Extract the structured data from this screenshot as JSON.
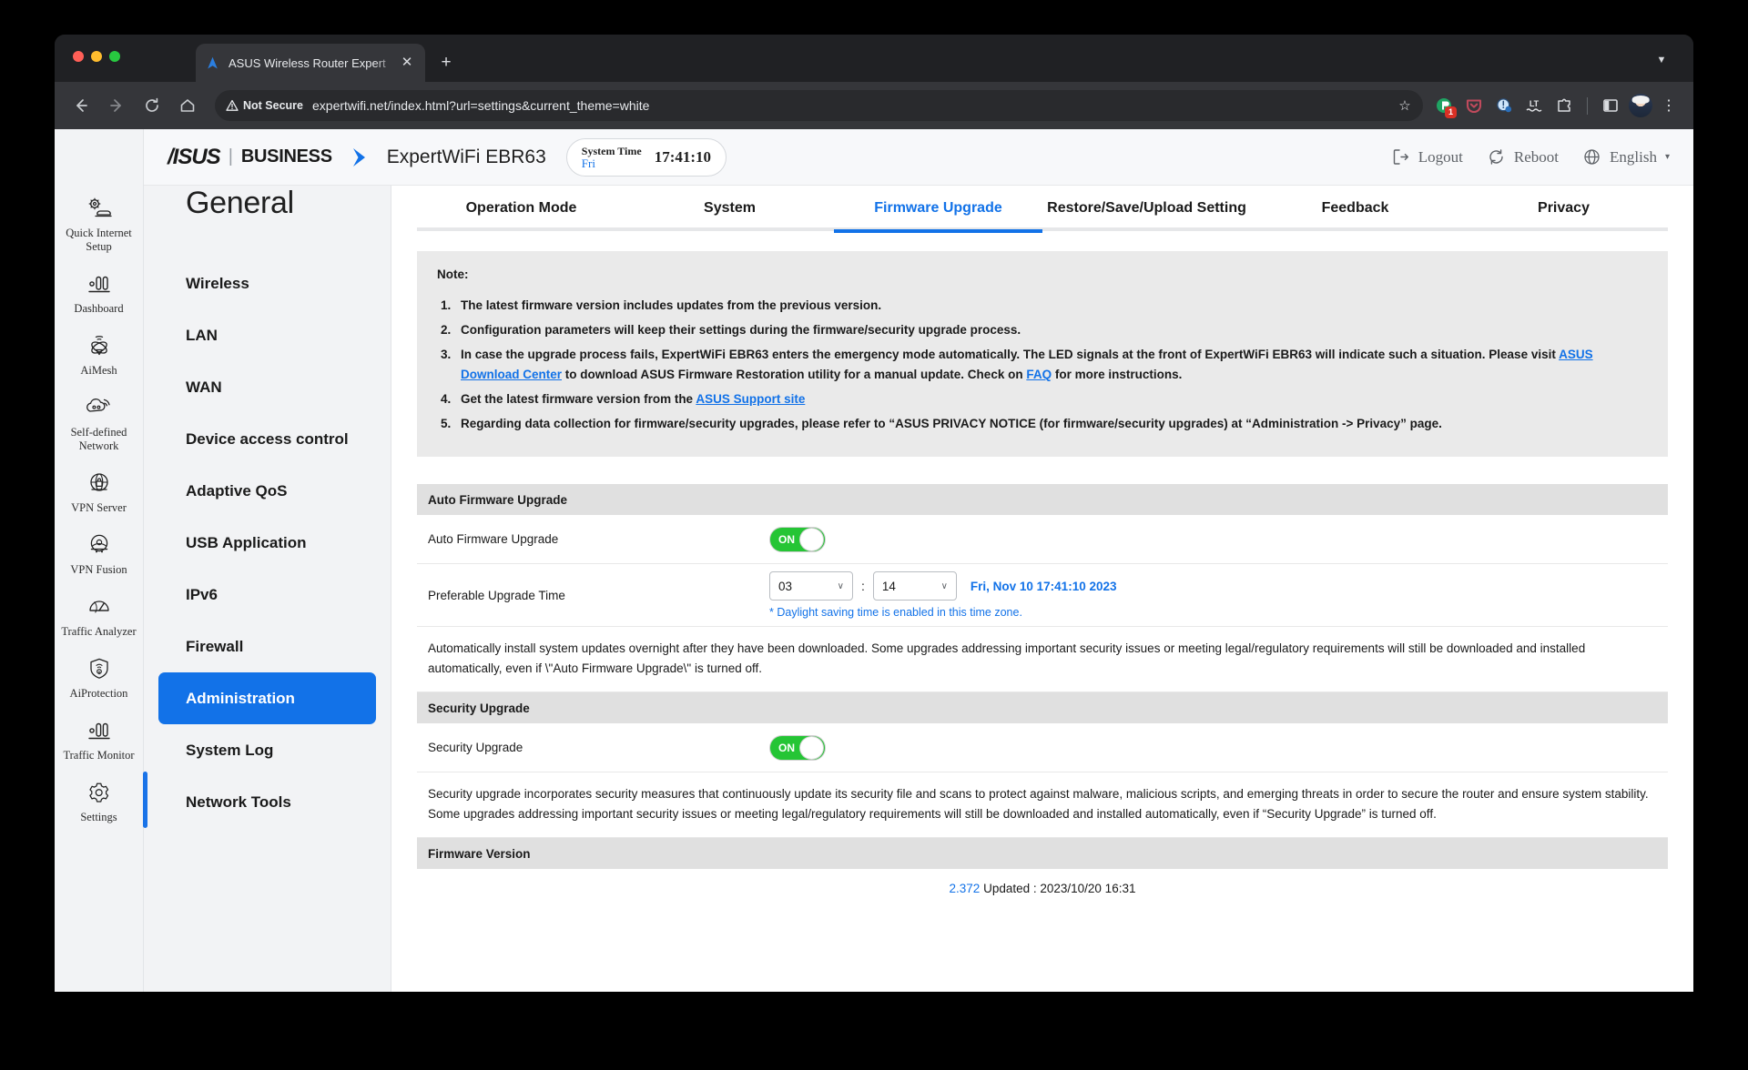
{
  "browser": {
    "tab": {
      "title": "ASUS Wireless Router Expert",
      "close_label": "✕"
    },
    "new_tab_label": "+",
    "tab_list_label": "▼",
    "nav": {
      "back": "←",
      "forward": "→",
      "reload": "⟳",
      "home": "⌂"
    },
    "omnibox": {
      "security_label": "Not Secure",
      "warning_icon": "warning-triangle-icon",
      "url": "expertwifi.net/index.html?url=settings&current_theme=white",
      "star": "☆"
    },
    "extensions": [
      {
        "name": "password-manager-extension",
        "badge": "1"
      },
      {
        "name": "pocket-extension",
        "badge": ""
      },
      {
        "name": "privacy-badger-extension",
        "badge": ""
      },
      {
        "name": "languagetool-extension",
        "badge": ""
      },
      {
        "name": "extensions-puzzle-icon",
        "badge": ""
      }
    ],
    "side_panel_label": "side-panel-icon",
    "profile_label": "profile-avatar",
    "menu_label": "⋮"
  },
  "header": {
    "brand": "/ISUS",
    "divider": "|",
    "business": "BUSINESS",
    "model": "ExpertWiFi EBR63",
    "system_time": {
      "label": "System Time",
      "day": "Fri",
      "clock": "17:41:10"
    },
    "logout": "Logout",
    "reboot": "Reboot",
    "language": "English",
    "language_caret": "▾"
  },
  "rail": {
    "items": [
      {
        "label": "Quick Internet Setup",
        "icon": "quick-internet-setup-icon",
        "active": false
      },
      {
        "label": "Dashboard",
        "icon": "dashboard-bars-icon",
        "active": false
      },
      {
        "label": "AiMesh",
        "icon": "aimesh-icon",
        "active": false
      },
      {
        "label": "Self-defined Network",
        "icon": "self-defined-network-icon",
        "active": false
      },
      {
        "label": "VPN Server",
        "icon": "vpn-server-icon",
        "active": false
      },
      {
        "label": "VPN Fusion",
        "icon": "vpn-fusion-icon",
        "active": false
      },
      {
        "label": "Traffic Analyzer",
        "icon": "traffic-analyzer-icon",
        "active": false
      },
      {
        "label": "AiProtection",
        "icon": "aiprotection-shield-icon",
        "active": false
      },
      {
        "label": "Traffic Monitor",
        "icon": "traffic-monitor-icon",
        "active": false
      },
      {
        "label": "Settings",
        "icon": "settings-gear-icon",
        "active": true
      }
    ]
  },
  "menu": {
    "title": "General",
    "items": [
      {
        "label": "Wireless",
        "selected": false
      },
      {
        "label": "LAN",
        "selected": false
      },
      {
        "label": "WAN",
        "selected": false
      },
      {
        "label": "Device access control",
        "selected": false
      },
      {
        "label": "Adaptive QoS",
        "selected": false
      },
      {
        "label": "USB Application",
        "selected": false
      },
      {
        "label": "IPv6",
        "selected": false
      },
      {
        "label": "Firewall",
        "selected": false
      },
      {
        "label": "Administration",
        "selected": true
      },
      {
        "label": "System Log",
        "selected": false
      },
      {
        "label": "Network Tools",
        "selected": false
      }
    ]
  },
  "tabs": [
    {
      "label": "Operation Mode",
      "active": false
    },
    {
      "label": "System",
      "active": false
    },
    {
      "label": "Firmware Upgrade",
      "active": true
    },
    {
      "label": "Restore/Save/Upload Setting",
      "active": false
    },
    {
      "label": "Feedback",
      "active": false
    },
    {
      "label": "Privacy",
      "active": false
    }
  ],
  "note": {
    "heading": "Note:",
    "items": [
      {
        "num": "1.",
        "parts": [
          {
            "t": "The latest firmware version includes updates from the previous version."
          }
        ]
      },
      {
        "num": "2.",
        "parts": [
          {
            "t": "Configuration parameters will keep their settings during the firmware/security upgrade process."
          }
        ]
      },
      {
        "num": "3.",
        "parts": [
          {
            "t": "In case the upgrade process fails, ExpertWiFi EBR63 enters the emergency mode automatically. The LED signals at the front of ExpertWiFi EBR63 will indicate such a situation. Please visit "
          },
          {
            "t": "ASUS Download Center",
            "link": true
          },
          {
            "t": " to download ASUS Firmware Restoration utility for a manual update. Check on "
          },
          {
            "t": "FAQ",
            "link": true
          },
          {
            "t": " for more instructions."
          }
        ]
      },
      {
        "num": "4.",
        "parts": [
          {
            "t": "Get the latest firmware version from the "
          },
          {
            "t": "ASUS Support site",
            "link": true
          }
        ]
      },
      {
        "num": "5.",
        "parts": [
          {
            "t": "Regarding data collection for firmware/security upgrades, please refer to “ASUS PRIVACY NOTICE (for firmware/security upgrades) at “Administration -> Privacy” page."
          }
        ]
      }
    ]
  },
  "auto_firmware": {
    "section_title": "Auto Firmware Upgrade",
    "toggle_label": "Auto Firmware Upgrade",
    "toggle_state": "ON",
    "time_label": "Preferable Upgrade Time",
    "hour": "03",
    "minute": "14",
    "colon": ":",
    "chevron": "∨",
    "system_datetime": "Fri, Nov 10 17:41:10 2023",
    "dst_note": "* Daylight saving time is enabled in this time zone.",
    "description": "Automatically install system updates overnight after they have been downloaded. Some upgrades addressing important security issues or meeting legal/regulatory requirements will still be downloaded and installed automatically, even if \\\"Auto Firmware Upgrade\\\" is turned off."
  },
  "security_upgrade": {
    "section_title": "Security Upgrade",
    "toggle_label": "Security Upgrade",
    "toggle_state": "ON",
    "description": "Security upgrade incorporates security measures that continuously update its security file and scans to protect against malware, malicious scripts, and emerging threats in order to secure the router and ensure system stability. Some upgrades addressing important security issues or meeting legal/regulatory requirements will still be downloaded and installed automatically, even if “Security Upgrade” is turned off."
  },
  "firmware_version": {
    "section_title": "Firmware Version",
    "version": "2.372",
    "updated": "Updated : 2023/10/20 16:31"
  },
  "colors": {
    "accent_blue": "#1272e8",
    "toggle_green": "#25c535",
    "note_bg": "#eaeaea",
    "section_bg": "#e0e0e0"
  }
}
